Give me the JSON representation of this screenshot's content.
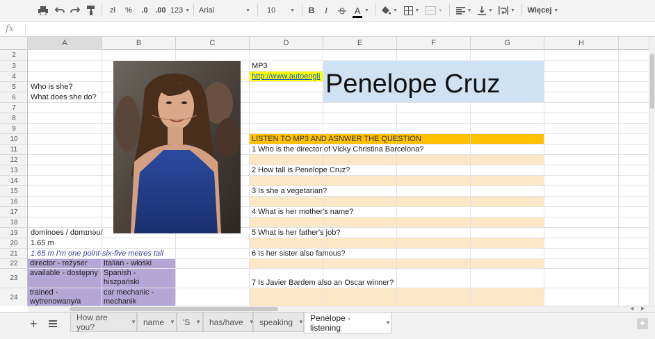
{
  "toolbar": {
    "currency": "zł",
    "percent": "%",
    "decrease_decimals": ".0",
    "increase_decimals": ".00",
    "number_format": "123",
    "font": "Arial",
    "font_size": "10",
    "bold": "B",
    "italic": "I",
    "text_color": "A",
    "more": "Więcej"
  },
  "formula_bar": {
    "fx": "fx",
    "value": ""
  },
  "columns": [
    "A",
    "B",
    "C",
    "D",
    "E",
    "F",
    "G",
    "H"
  ],
  "rows": [
    "2",
    "3",
    "4",
    "5",
    "6",
    "7",
    "8",
    "9",
    "10",
    "11",
    "12",
    "13",
    "14",
    "15",
    "16",
    "17",
    "18",
    "19",
    "20",
    "21",
    "22",
    "23",
    "24"
  ],
  "cells": {
    "a5": "Who is she?",
    "a6": "What does she do?",
    "a19": "dominoes / dɒmɪnəʊ/",
    "a20": "1.65 m",
    "a21": "1.65 m I'm one point-six-five metres tall",
    "a22": "director - reżyser",
    "b22": "Italian - włoski",
    "a23": "available - dostępny",
    "b23": "Spanish - hiszpański",
    "a24": "trained - wytrenowany/a",
    "b24": "car mechanic - mechanik",
    "d3": "MP3",
    "d4": "http://www.autoengli",
    "e3_title": "Penelope Cruz",
    "d10": "LISTEN TO MP3 AND ASNWER THE QUESTION",
    "d11": "1 Who is the director of Vicky Christina Barcelona?",
    "d13": "2 How tall is Penelope Cruz?",
    "d15": "3 Is she a vegetarian?",
    "d17": "4 What is her mother's name?",
    "d19": "5 What is her father's job?",
    "d21": "6 Is her sister also famous?",
    "d23": "7 Is Javier Bardem also an Oscar winner?"
  },
  "sheets": [
    {
      "label": "How are you?",
      "active": false
    },
    {
      "label": "name",
      "active": false
    },
    {
      "label": "'S",
      "active": false
    },
    {
      "label": "has/have",
      "active": false
    },
    {
      "label": "speaking",
      "active": false
    },
    {
      "label": "Penelope - listening",
      "active": true
    }
  ],
  "colors": {
    "title_fill": "#cfe2f3",
    "header_orange": "#ffc000",
    "answer_fill": "#fce8c6",
    "vocab_purple": "#b4a7d6",
    "link_yellow": "#ffff00",
    "link_text": "#1155cc"
  },
  "icons": [
    "print-icon",
    "undo-icon",
    "redo-icon",
    "paint-format-icon",
    "fill-color-icon",
    "borders-icon",
    "merge-icon",
    "align-left-icon",
    "valign-bottom-icon",
    "wrap-icon",
    "add-sheet-icon",
    "sheet-list-icon",
    "explore-icon"
  ]
}
